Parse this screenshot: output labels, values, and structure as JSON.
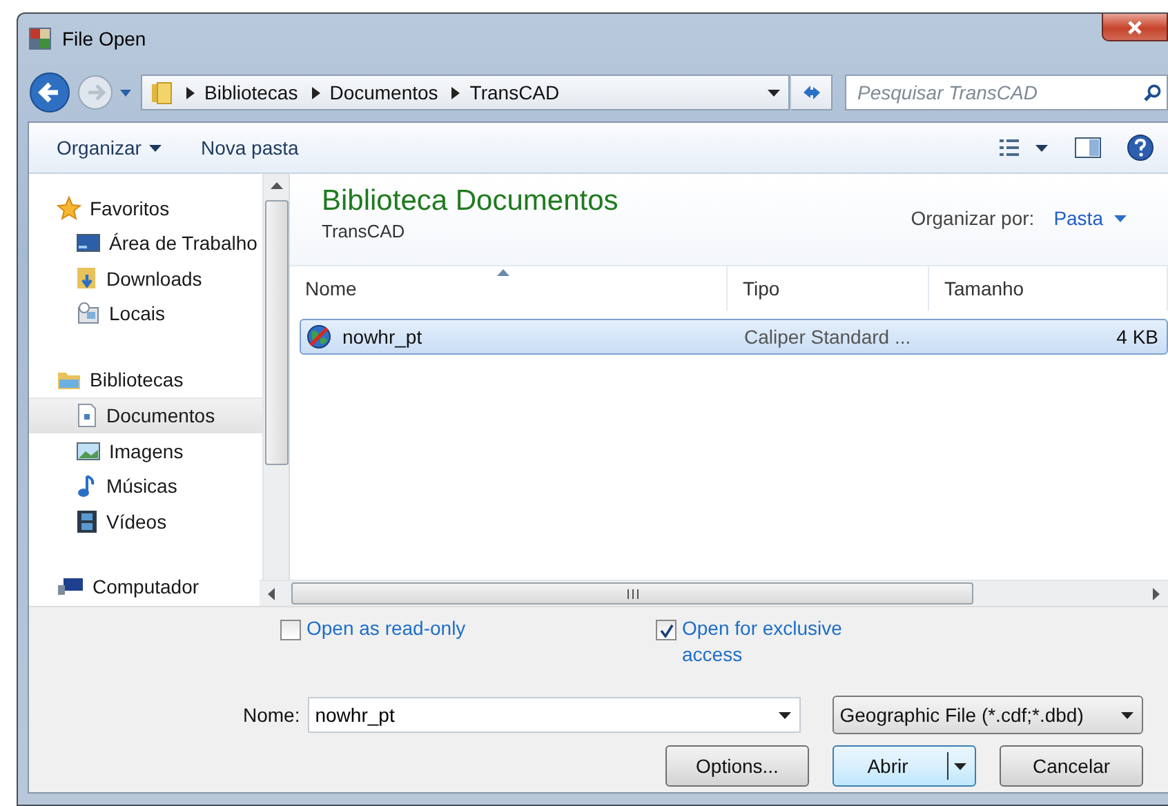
{
  "window": {
    "title": "File Open"
  },
  "address": {
    "path": [
      "Bibliotecas",
      "Documentos",
      "TransCAD"
    ]
  },
  "search": {
    "placeholder": "Pesquisar TransCAD"
  },
  "toolbar": {
    "organize": "Organizar",
    "new_folder": "Nova pasta"
  },
  "sidebar": {
    "groups": [
      {
        "label": "Favoritos",
        "children": [
          {
            "label": "Área de Trabalho",
            "selected": false
          },
          {
            "label": "Downloads",
            "selected": false
          },
          {
            "label": "Locais",
            "selected": false
          }
        ]
      },
      {
        "label": "Bibliotecas",
        "children": [
          {
            "label": "Documentos",
            "selected": true
          },
          {
            "label": "Imagens",
            "selected": false
          },
          {
            "label": "Músicas",
            "selected": false
          },
          {
            "label": "Vídeos",
            "selected": false
          }
        ]
      },
      {
        "label": "Computador"
      }
    ]
  },
  "library": {
    "title": "Biblioteca Documentos",
    "subtitle": "TransCAD",
    "arrange_label": "Organizar por:",
    "arrange_value": "Pasta"
  },
  "table": {
    "columns": [
      "Nome",
      "Tipo",
      "Tamanho"
    ],
    "rows": [
      {
        "name": "nowhr_pt",
        "type": "Caliper Standard ...",
        "size": "4 KB",
        "selected": true
      }
    ]
  },
  "options": [
    {
      "label": "Open as read-only",
      "checked": false
    },
    {
      "label": "Open for exclusive access",
      "checked": true
    }
  ],
  "file_name": {
    "label": "Nome:",
    "value": "nowhr_pt"
  },
  "file_type": {
    "value": "Geographic File (*.cdf;*.dbd)"
  },
  "buttons": [
    {
      "label": "Options...",
      "kind": "plain"
    },
    {
      "label": "Abrir",
      "kind": "split"
    },
    {
      "label": "Cancelar",
      "kind": "plain"
    }
  ]
}
